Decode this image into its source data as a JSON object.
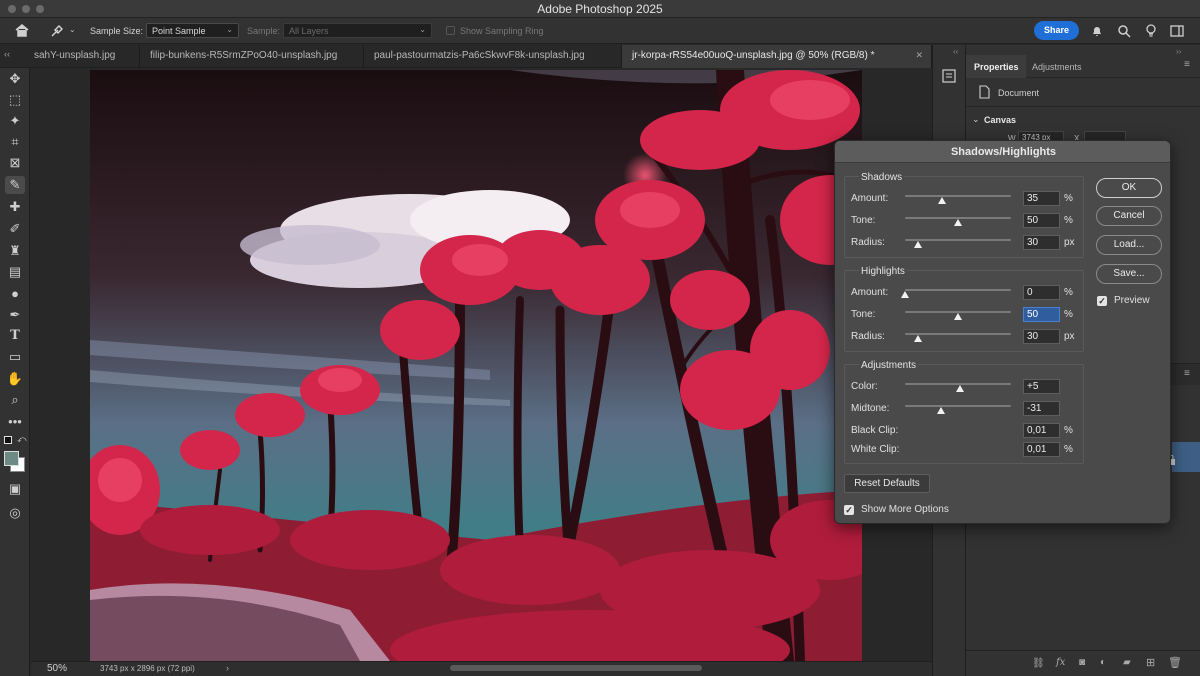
{
  "window": {
    "title": "Adobe Photoshop 2025"
  },
  "options_bar": {
    "sample_size_label": "Sample Size:",
    "sample_size_value": "Point Sample",
    "sample_label": "Sample:",
    "sample_value": "All Layers",
    "show_sampling_ring": "Show Sampling Ring",
    "share_label": "Share"
  },
  "tabs": [
    {
      "label": "sahY-unsplash.jpg",
      "active": false
    },
    {
      "label": "filip-bunkens-R5SrmZPoO40-unsplash.jpg",
      "active": false
    },
    {
      "label": "paul-pastourmatzis-Pa6cSkwvF8k-unsplash.jpg",
      "active": false
    },
    {
      "label": "jr-korpa-rRS54e00uoQ-unsplash.jpg @ 50% (RGB/8) *",
      "active": true
    }
  ],
  "status": {
    "zoom": "50%",
    "doc_info": "3743 px x 2896 px (72 ppi)"
  },
  "properties": {
    "tab_properties": "Properties",
    "tab_adjustments": "Adjustments",
    "document_label": "Document",
    "canvas_label": "Canvas",
    "w_label": "W",
    "w_value": "3743 px",
    "x_label": "X"
  },
  "dialog": {
    "title": "Shadows/Highlights",
    "shadows": {
      "title": "Shadows",
      "amount": {
        "label": "Amount:",
        "value": "35",
        "unit": "%",
        "fraction": 0.35
      },
      "tone": {
        "label": "Tone:",
        "value": "50",
        "unit": "%",
        "fraction": 0.5
      },
      "radius": {
        "label": "Radius:",
        "value": "30",
        "unit": "px",
        "fraction": 0.12
      }
    },
    "highlights": {
      "title": "Highlights",
      "amount": {
        "label": "Amount:",
        "value": "0",
        "unit": "%",
        "fraction": 0.0
      },
      "tone": {
        "label": "Tone:",
        "value": "50",
        "unit": "%",
        "fraction": 0.5
      },
      "radius": {
        "label": "Radius:",
        "value": "30",
        "unit": "px",
        "fraction": 0.12
      }
    },
    "adjustments": {
      "title": "Adjustments",
      "color": {
        "label": "Color:",
        "value": "+5",
        "fraction": 0.52
      },
      "midtone": {
        "label": "Midtone:",
        "value": "-31",
        "fraction": 0.34
      },
      "black_clip": {
        "label": "Black Clip:",
        "value": "0,01",
        "unit": "%"
      },
      "white_clip": {
        "label": "White Clip:",
        "value": "0,01",
        "unit": "%"
      }
    },
    "buttons": {
      "ok": "OK",
      "cancel": "Cancel",
      "load": "Load...",
      "save": "Save...",
      "reset": "Reset Defaults"
    },
    "preview_label": "Preview",
    "show_more_label": "Show More Options"
  },
  "colors": {
    "accent": "#1f6fd7",
    "panel": "#323232",
    "dialog": "#4a4a4a"
  }
}
